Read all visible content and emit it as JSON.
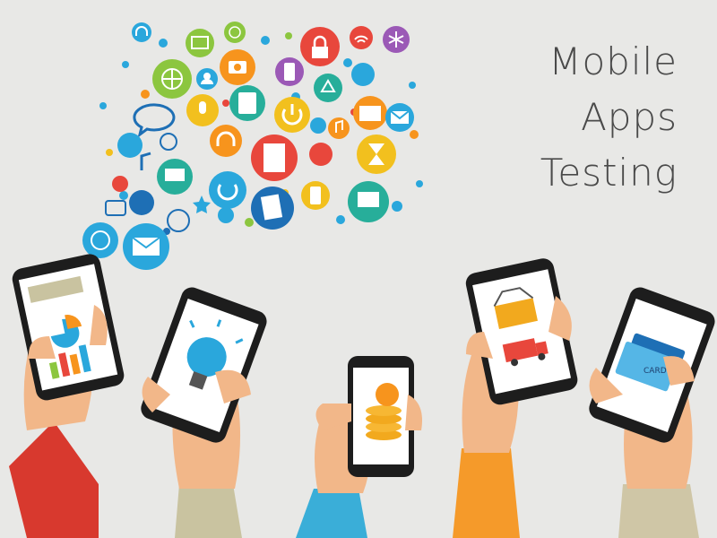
{
  "title_lines": [
    "Mobile",
    "Apps",
    "Testing"
  ],
  "card_label": "CARD",
  "colors": {
    "background": "#e8e8e6",
    "title_text": "#4a4a4a",
    "sleeve_red": "#d8392e",
    "sleeve_olive": "#c9c3a0",
    "sleeve_teal": "#3aaed8",
    "sleeve_orange": "#f59a2a",
    "sleeve_khaki": "#cfc6a6",
    "skin": "#f2b789",
    "phone_body": "#1d1d1d",
    "icon_palette": [
      "#2aa7dc",
      "#8cc63f",
      "#f7941d",
      "#e8473c",
      "#9b59b6",
      "#f2c01e",
      "#27ae9a",
      "#1e6fb5"
    ]
  },
  "icons": [
    "headset-icon",
    "globe-icon",
    "image-icon",
    "lock-icon",
    "wifi-icon",
    "asterisk-icon",
    "user-icon",
    "phone-icon",
    "recycle-icon",
    "camera-icon",
    "chat-icon",
    "music-icon",
    "folder-icon",
    "mail-icon",
    "mic-icon",
    "power-icon",
    "document-icon",
    "hourglass-icon",
    "laptop-icon",
    "tablet-icon",
    "monitor-icon",
    "star-icon",
    "refresh-icon",
    "globe2-icon",
    "email-icon"
  ]
}
